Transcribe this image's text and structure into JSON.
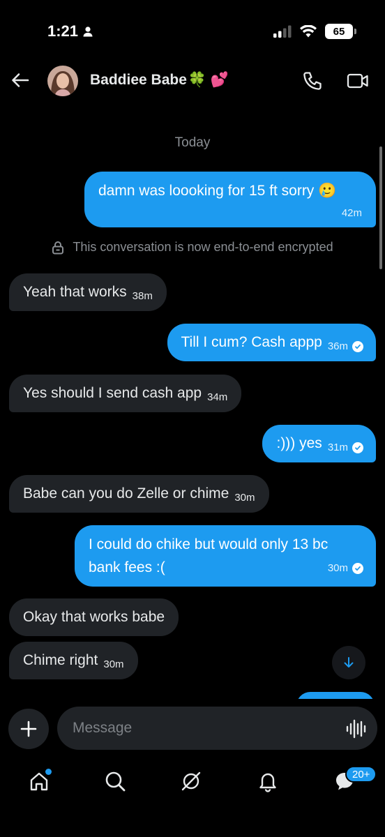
{
  "status_bar": {
    "time": "1:21",
    "battery": "65"
  },
  "header": {
    "contact_name": "Baddiee Babe",
    "name_emojis": "🍀 💕"
  },
  "chat": {
    "date_separator": "Today",
    "encryption_notice": "This conversation is now end-to-end encrypted",
    "messages": [
      {
        "direction": "out",
        "text": "damn was loooking for 15 ft sorry 🥲",
        "time": "42m"
      },
      {
        "direction": "in",
        "text": "Yeah that works",
        "time": "38m"
      },
      {
        "direction": "out",
        "text": "Till I cum? Cash appp",
        "time": "36m",
        "read": true
      },
      {
        "direction": "in",
        "text": "Yes should I send cash app",
        "time": "34m"
      },
      {
        "direction": "out",
        "text": ":))) yes",
        "time": "31m",
        "read": true
      },
      {
        "direction": "in",
        "text": "Babe can you do Zelle or chime",
        "time": "30m"
      },
      {
        "direction": "out",
        "text": "I could do chike but would only 13 bc bank fees :(",
        "time": "30m",
        "read": true
      },
      {
        "direction": "in",
        "text": "Okay that works babe",
        "time": ""
      },
      {
        "direction": "in",
        "text": "Chime right",
        "time": "30m"
      }
    ]
  },
  "composer": {
    "placeholder": "Message"
  },
  "tabbar": {
    "notification_badge": "20+"
  },
  "colors": {
    "accent": "#1d9bf0",
    "incoming_bubble": "#202327",
    "background": "#000000"
  }
}
